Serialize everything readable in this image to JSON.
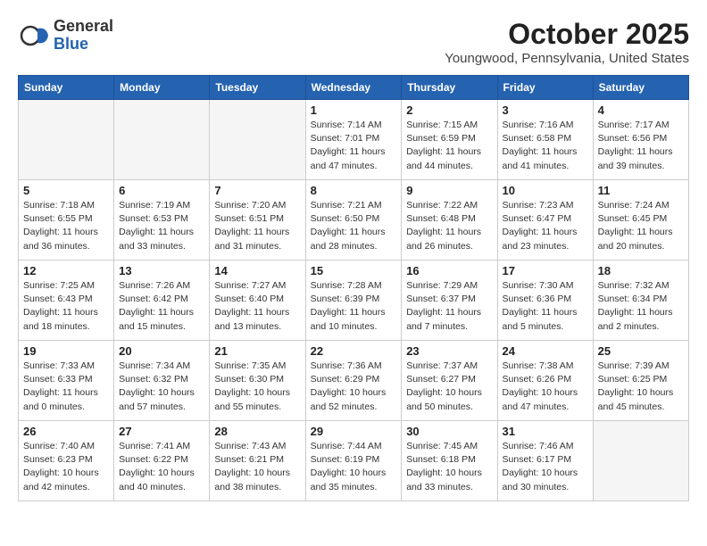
{
  "logo": {
    "general": "General",
    "blue": "Blue"
  },
  "title": "October 2025",
  "location": "Youngwood, Pennsylvania, United States",
  "days_of_week": [
    "Sunday",
    "Monday",
    "Tuesday",
    "Wednesday",
    "Thursday",
    "Friday",
    "Saturday"
  ],
  "weeks": [
    [
      {
        "day": "",
        "info": ""
      },
      {
        "day": "",
        "info": ""
      },
      {
        "day": "",
        "info": ""
      },
      {
        "day": "1",
        "info": "Sunrise: 7:14 AM\nSunset: 7:01 PM\nDaylight: 11 hours\nand 47 minutes."
      },
      {
        "day": "2",
        "info": "Sunrise: 7:15 AM\nSunset: 6:59 PM\nDaylight: 11 hours\nand 44 minutes."
      },
      {
        "day": "3",
        "info": "Sunrise: 7:16 AM\nSunset: 6:58 PM\nDaylight: 11 hours\nand 41 minutes."
      },
      {
        "day": "4",
        "info": "Sunrise: 7:17 AM\nSunset: 6:56 PM\nDaylight: 11 hours\nand 39 minutes."
      }
    ],
    [
      {
        "day": "5",
        "info": "Sunrise: 7:18 AM\nSunset: 6:55 PM\nDaylight: 11 hours\nand 36 minutes."
      },
      {
        "day": "6",
        "info": "Sunrise: 7:19 AM\nSunset: 6:53 PM\nDaylight: 11 hours\nand 33 minutes."
      },
      {
        "day": "7",
        "info": "Sunrise: 7:20 AM\nSunset: 6:51 PM\nDaylight: 11 hours\nand 31 minutes."
      },
      {
        "day": "8",
        "info": "Sunrise: 7:21 AM\nSunset: 6:50 PM\nDaylight: 11 hours\nand 28 minutes."
      },
      {
        "day": "9",
        "info": "Sunrise: 7:22 AM\nSunset: 6:48 PM\nDaylight: 11 hours\nand 26 minutes."
      },
      {
        "day": "10",
        "info": "Sunrise: 7:23 AM\nSunset: 6:47 PM\nDaylight: 11 hours\nand 23 minutes."
      },
      {
        "day": "11",
        "info": "Sunrise: 7:24 AM\nSunset: 6:45 PM\nDaylight: 11 hours\nand 20 minutes."
      }
    ],
    [
      {
        "day": "12",
        "info": "Sunrise: 7:25 AM\nSunset: 6:43 PM\nDaylight: 11 hours\nand 18 minutes."
      },
      {
        "day": "13",
        "info": "Sunrise: 7:26 AM\nSunset: 6:42 PM\nDaylight: 11 hours\nand 15 minutes."
      },
      {
        "day": "14",
        "info": "Sunrise: 7:27 AM\nSunset: 6:40 PM\nDaylight: 11 hours\nand 13 minutes."
      },
      {
        "day": "15",
        "info": "Sunrise: 7:28 AM\nSunset: 6:39 PM\nDaylight: 11 hours\nand 10 minutes."
      },
      {
        "day": "16",
        "info": "Sunrise: 7:29 AM\nSunset: 6:37 PM\nDaylight: 11 hours\nand 7 minutes."
      },
      {
        "day": "17",
        "info": "Sunrise: 7:30 AM\nSunset: 6:36 PM\nDaylight: 11 hours\nand 5 minutes."
      },
      {
        "day": "18",
        "info": "Sunrise: 7:32 AM\nSunset: 6:34 PM\nDaylight: 11 hours\nand 2 minutes."
      }
    ],
    [
      {
        "day": "19",
        "info": "Sunrise: 7:33 AM\nSunset: 6:33 PM\nDaylight: 11 hours\nand 0 minutes."
      },
      {
        "day": "20",
        "info": "Sunrise: 7:34 AM\nSunset: 6:32 PM\nDaylight: 10 hours\nand 57 minutes."
      },
      {
        "day": "21",
        "info": "Sunrise: 7:35 AM\nSunset: 6:30 PM\nDaylight: 10 hours\nand 55 minutes."
      },
      {
        "day": "22",
        "info": "Sunrise: 7:36 AM\nSunset: 6:29 PM\nDaylight: 10 hours\nand 52 minutes."
      },
      {
        "day": "23",
        "info": "Sunrise: 7:37 AM\nSunset: 6:27 PM\nDaylight: 10 hours\nand 50 minutes."
      },
      {
        "day": "24",
        "info": "Sunrise: 7:38 AM\nSunset: 6:26 PM\nDaylight: 10 hours\nand 47 minutes."
      },
      {
        "day": "25",
        "info": "Sunrise: 7:39 AM\nSunset: 6:25 PM\nDaylight: 10 hours\nand 45 minutes."
      }
    ],
    [
      {
        "day": "26",
        "info": "Sunrise: 7:40 AM\nSunset: 6:23 PM\nDaylight: 10 hours\nand 42 minutes."
      },
      {
        "day": "27",
        "info": "Sunrise: 7:41 AM\nSunset: 6:22 PM\nDaylight: 10 hours\nand 40 minutes."
      },
      {
        "day": "28",
        "info": "Sunrise: 7:43 AM\nSunset: 6:21 PM\nDaylight: 10 hours\nand 38 minutes."
      },
      {
        "day": "29",
        "info": "Sunrise: 7:44 AM\nSunset: 6:19 PM\nDaylight: 10 hours\nand 35 minutes."
      },
      {
        "day": "30",
        "info": "Sunrise: 7:45 AM\nSunset: 6:18 PM\nDaylight: 10 hours\nand 33 minutes."
      },
      {
        "day": "31",
        "info": "Sunrise: 7:46 AM\nSunset: 6:17 PM\nDaylight: 10 hours\nand 30 minutes."
      },
      {
        "day": "",
        "info": ""
      }
    ]
  ]
}
